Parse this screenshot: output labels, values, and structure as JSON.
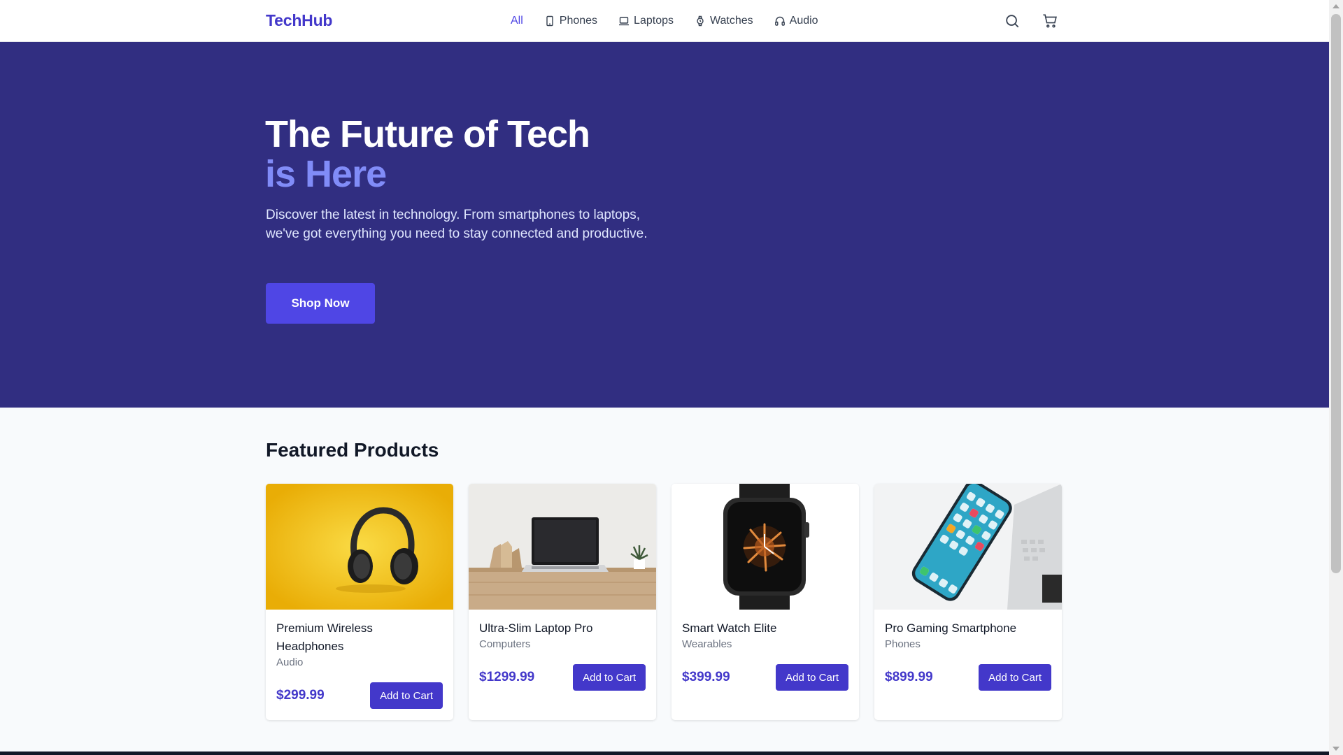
{
  "header": {
    "logo": "TechHub",
    "nav": [
      {
        "label": "All",
        "icon": "none",
        "active": true
      },
      {
        "label": "Phones",
        "icon": "phone-icon"
      },
      {
        "label": "Laptops",
        "icon": "laptop-icon"
      },
      {
        "label": "Watches",
        "icon": "watch-icon"
      },
      {
        "label": "Audio",
        "icon": "headphones-icon"
      }
    ],
    "icons": [
      "search-icon",
      "cart-icon"
    ]
  },
  "hero": {
    "title_line1": "The Future of Tech",
    "title_line2": "is Here",
    "description": "Discover the latest in technology. From smartphones to laptops, we've got everything you need to stay connected and productive.",
    "cta": "Shop Now"
  },
  "featured": {
    "title": "Featured Products",
    "products": [
      {
        "name": "Premium Wireless Headphones",
        "category": "Audio",
        "price": "$299.99",
        "button": "Add to Cart"
      },
      {
        "name": "Ultra-Slim Laptop Pro",
        "category": "Computers",
        "price": "$1299.99",
        "button": "Add to Cart"
      },
      {
        "name": "Smart Watch Elite",
        "category": "Wearables",
        "price": "$399.99",
        "button": "Add to Cart"
      },
      {
        "name": "Pro Gaming Smartphone",
        "category": "Phones",
        "price": "$899.99",
        "button": "Add to Cart"
      }
    ]
  },
  "colors": {
    "brand": "#4338ca",
    "hero_bg": "#312e81",
    "accent": "#818cf8",
    "button": "#4f46e5"
  }
}
